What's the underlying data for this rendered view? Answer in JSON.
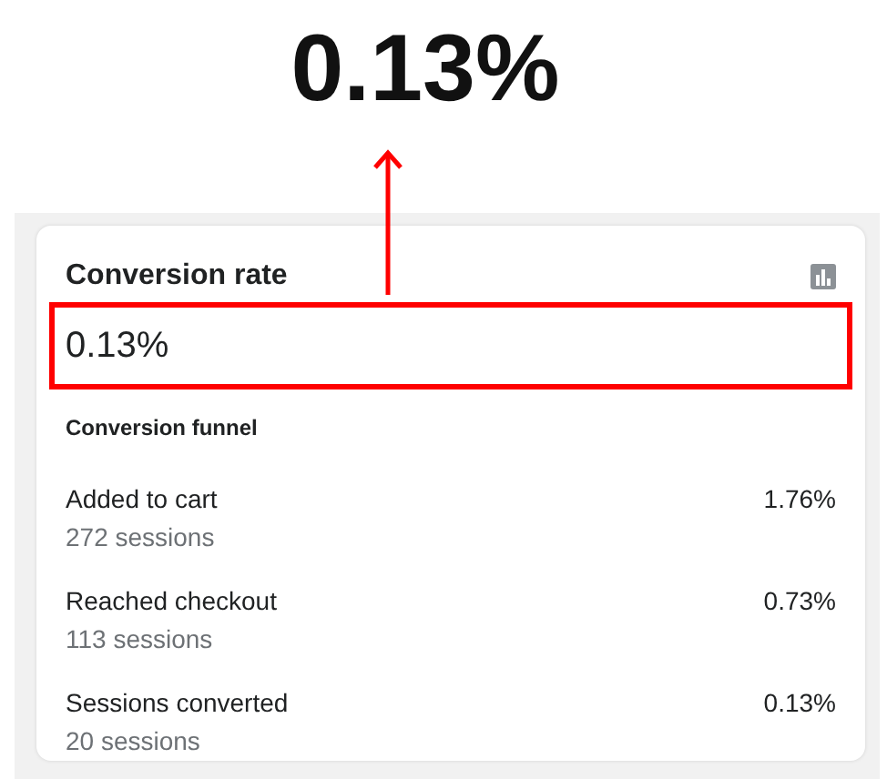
{
  "headline": "0.13%",
  "card": {
    "title": "Conversion rate",
    "value": "0.13%",
    "funnel_title": "Conversion funnel",
    "funnel": [
      {
        "label": "Added to cart",
        "sessions": "272 sessions",
        "rate": "1.76%"
      },
      {
        "label": "Reached checkout",
        "sessions": "113 sessions",
        "rate": "0.73%"
      },
      {
        "label": "Sessions converted",
        "sessions": "20 sessions",
        "rate": "0.13%"
      }
    ]
  }
}
